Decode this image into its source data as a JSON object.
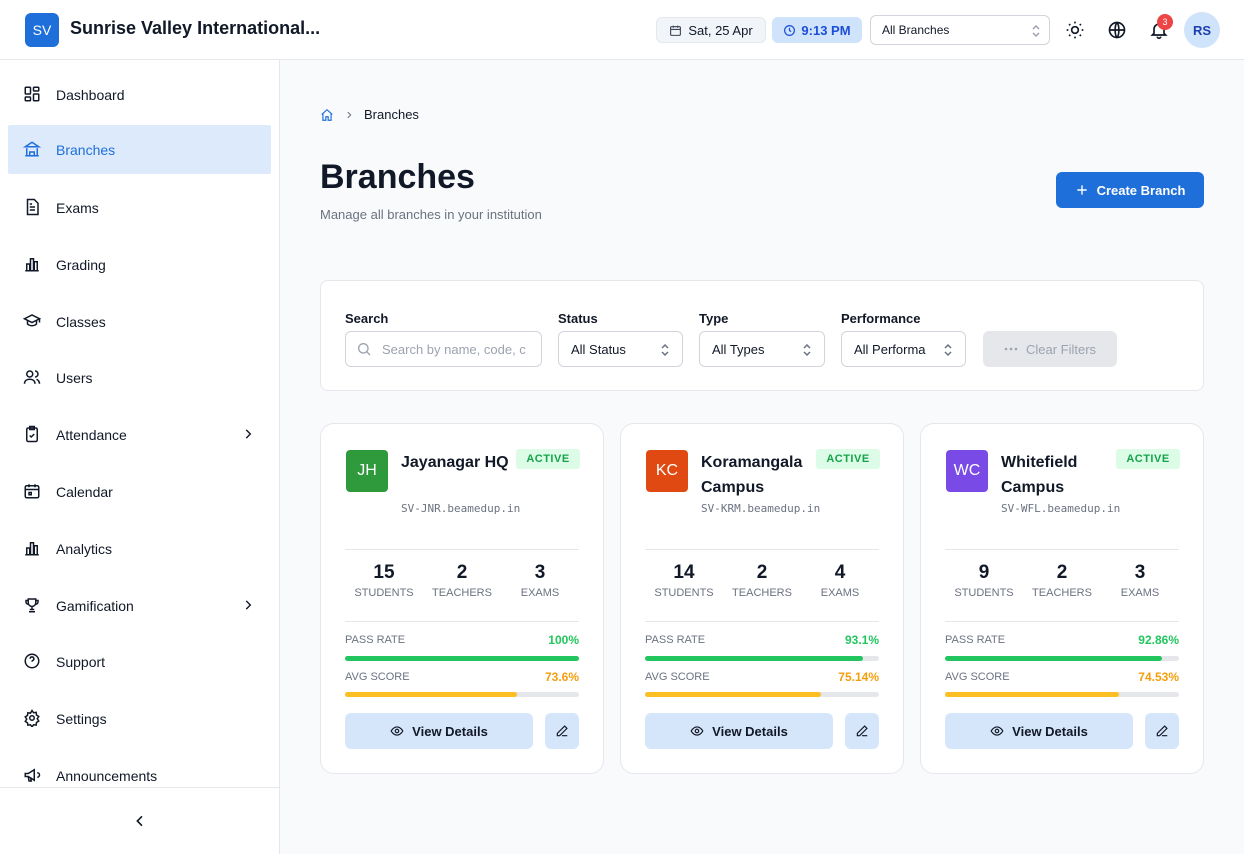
{
  "app": {
    "logo": "SV",
    "title": "Sunrise Valley International..."
  },
  "header": {
    "date": "Sat, 25 Apr",
    "time": "9:13 PM",
    "branch_select": "All Branches",
    "notifications": "3",
    "avatar": "RS"
  },
  "sidebar": {
    "items": [
      {
        "label": "Dashboard",
        "icon": "dashboard-icon"
      },
      {
        "label": "Branches",
        "icon": "branches-icon"
      },
      {
        "label": "Exams",
        "icon": "exams-icon"
      },
      {
        "label": "Grading",
        "icon": "grading-icon"
      },
      {
        "label": "Classes",
        "icon": "graduation-cap-icon"
      },
      {
        "label": "Users",
        "icon": "users-icon"
      },
      {
        "label": "Attendance",
        "icon": "attendance-icon"
      },
      {
        "label": "Calendar",
        "icon": "calendar-icon"
      },
      {
        "label": "Analytics",
        "icon": "analytics-icon"
      },
      {
        "label": "Gamification",
        "icon": "trophy-icon"
      },
      {
        "label": "Support",
        "icon": "help-icon"
      },
      {
        "label": "Settings",
        "icon": "gear-icon"
      },
      {
        "label": "Announcements",
        "icon": "megaphone-icon"
      }
    ]
  },
  "breadcrumb": {
    "current": "Branches"
  },
  "page": {
    "title": "Branches",
    "subtitle": "Manage all branches in your institution",
    "create_label": "Create Branch"
  },
  "filters": {
    "search_label": "Search",
    "search_placeholder": "Search by name, code, c",
    "status_label": "Status",
    "status_value": "All Status",
    "type_label": "Type",
    "type_value": "All Types",
    "performance_label": "Performance",
    "performance_value": "All Performa",
    "clear_label": "Clear Filters"
  },
  "cards": [
    {
      "initials": "JH",
      "color": "#2f9a3c",
      "name": "Jayanagar HQ",
      "domain": "SV-JNR.beamedup.in",
      "status": "ACTIVE",
      "students": "15",
      "teachers": "2",
      "exams": "3",
      "pass_rate_label": "PASS RATE",
      "pass_rate": "100%",
      "pass_rate_value": 100,
      "avg_score_label": "AVG SCORE",
      "avg_score": "73.6%",
      "avg_score_value": 73.6,
      "view_label": "View Details"
    },
    {
      "initials": "KC",
      "color": "#e04a12",
      "name": "Koramangala Campus",
      "domain": "SV-KRM.beamedup.in",
      "status": "ACTIVE",
      "students": "14",
      "teachers": "2",
      "exams": "4",
      "pass_rate_label": "PASS RATE",
      "pass_rate": "93.1%",
      "pass_rate_value": 93.1,
      "avg_score_label": "AVG SCORE",
      "avg_score": "75.14%",
      "avg_score_value": 75.14,
      "view_label": "View Details"
    },
    {
      "initials": "WC",
      "color": "#7a4ae6",
      "name": "Whitefield Campus",
      "domain": "SV-WFL.beamedup.in",
      "status": "ACTIVE",
      "students": "9",
      "teachers": "2",
      "exams": "3",
      "pass_rate_label": "PASS RATE",
      "pass_rate": "92.86%",
      "pass_rate_value": 92.86,
      "avg_score_label": "AVG SCORE",
      "avg_score": "74.53%",
      "avg_score_value": 74.53,
      "view_label": "View Details"
    }
  ],
  "stat_labels": {
    "students": "STUDENTS",
    "teachers": "TEACHERS",
    "exams": "EXAMS"
  },
  "colors": {
    "accent": "#1e6fd9",
    "pass": "#22c55e",
    "avg": "#fbbf24",
    "active_bg": "#ddeafb"
  }
}
